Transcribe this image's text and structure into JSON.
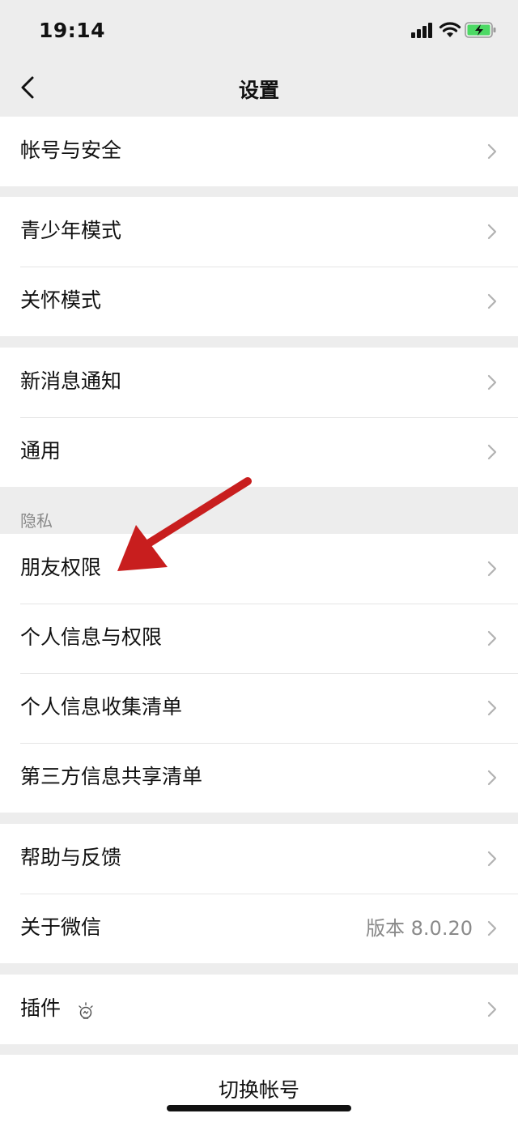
{
  "status_bar": {
    "time": "19:14"
  },
  "nav": {
    "title": "设置",
    "back_icon": "chevron-left-icon"
  },
  "groups": {
    "account": {
      "items": [
        {
          "label": "帐号与安全"
        }
      ]
    },
    "modes": {
      "items": [
        {
          "label": "青少年模式"
        },
        {
          "label": "关怀模式"
        }
      ]
    },
    "notify": {
      "items": [
        {
          "label": "新消息通知"
        },
        {
          "label": "通用"
        }
      ]
    },
    "privacy": {
      "header": "隐私",
      "items": [
        {
          "label": "朋友权限"
        },
        {
          "label": "个人信息与权限"
        },
        {
          "label": "个人信息收集清单"
        },
        {
          "label": "第三方信息共享清单"
        }
      ]
    },
    "help": {
      "items": [
        {
          "label": "帮助与反馈"
        },
        {
          "label": "关于微信",
          "value": "版本 8.0.20"
        }
      ]
    },
    "plugins": {
      "items": [
        {
          "label": "插件",
          "icon": "lightbulb-icon"
        }
      ]
    }
  },
  "footer": {
    "switch_account": "切换帐号"
  },
  "colors": {
    "background": "#ededed",
    "annotation_arrow": "#c81e1e",
    "battery_fill": "#4cd964"
  }
}
